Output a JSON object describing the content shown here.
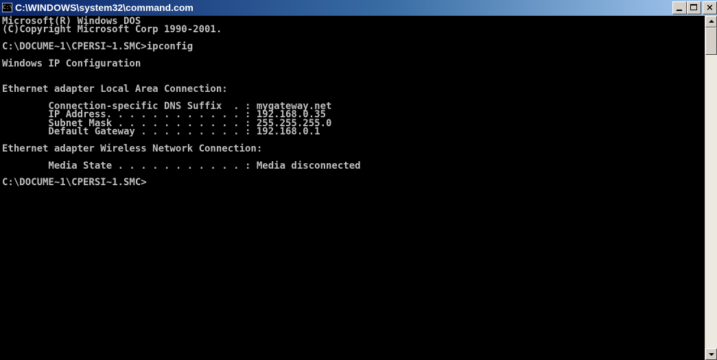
{
  "window": {
    "title": "C:\\WINDOWS\\system32\\command.com",
    "icon_text": "C:\\",
    "icons": {
      "app": "command-prompt-icon",
      "minimize": "minimize-icon",
      "maximize": "maximize-icon",
      "close": "close-icon"
    },
    "close_label": "×"
  },
  "colors": {
    "console_bg": "#000000",
    "console_text": "#c0c0c0",
    "titlebar_start": "#0a246a",
    "titlebar_end": "#a6caf0"
  },
  "console": {
    "lines": [
      "Microsoft(R) Windows DOS",
      "(C)Copyright Microsoft Corp 1990-2001.",
      "",
      "C:\\DOCUME~1\\CPERSI~1.SMC>ipconfig",
      "",
      "Windows IP Configuration",
      "",
      "",
      "Ethernet adapter Local Area Connection:",
      "",
      "        Connection-specific DNS Suffix  . : mygateway.net",
      "        IP Address. . . . . . . . . . . . : 192.168.0.35",
      "        Subnet Mask . . . . . . . . . . . : 255.255.255.0",
      "        Default Gateway . . . . . . . . . : 192.168.0.1",
      "",
      "Ethernet adapter Wireless Network Connection:",
      "",
      "        Media State . . . . . . . . . . . : Media disconnected",
      "",
      "C:\\DOCUME~1\\CPERSI~1.SMC>"
    ]
  },
  "scrollbar": {
    "up_icon": "scroll-up-arrow-icon",
    "down_icon": "scroll-down-arrow-icon"
  }
}
